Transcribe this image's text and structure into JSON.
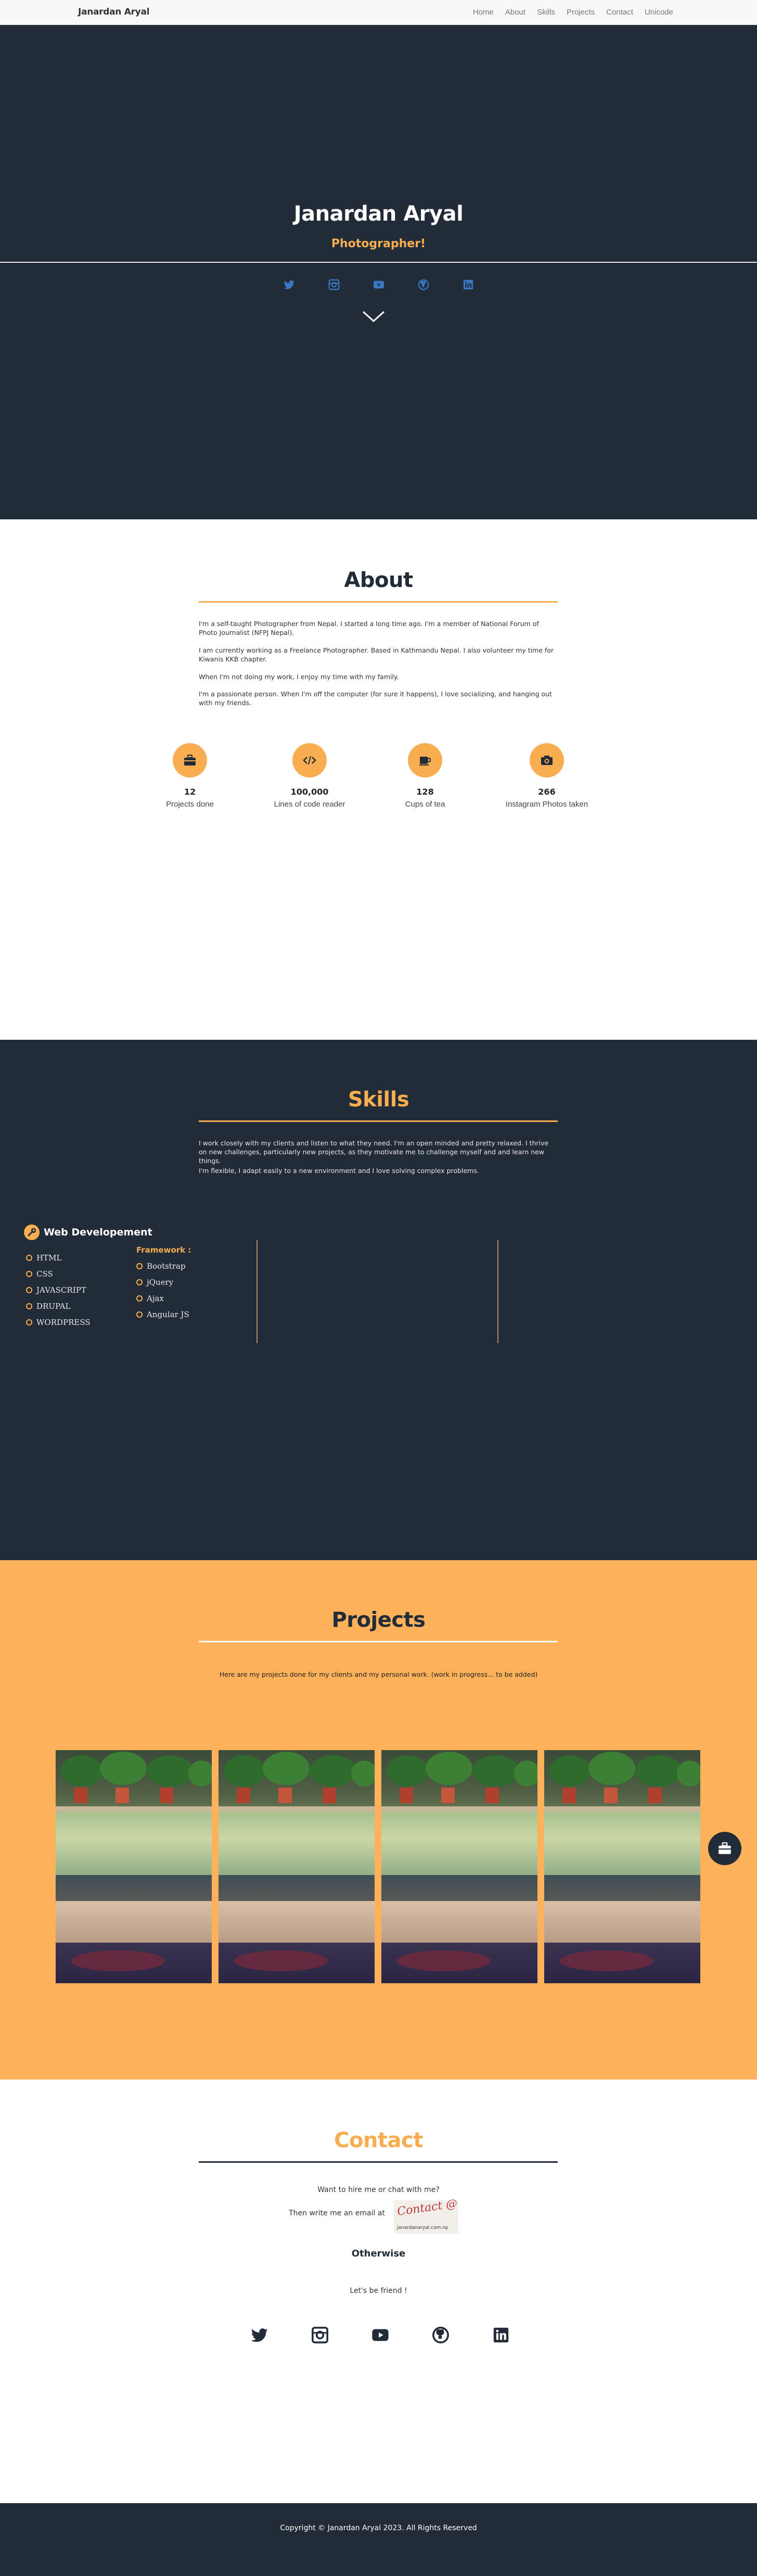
{
  "nav": {
    "brand": "Janardan Aryal",
    "links": [
      "Home",
      "About",
      "Skills",
      "Projects",
      "Contact",
      "Unicode"
    ]
  },
  "hero": {
    "name": "Janardan Aryal",
    "role": "Photographer!",
    "social_icons": [
      "twitter-icon",
      "instagram-icon",
      "youtube-icon",
      "github-icon",
      "linkedin-icon"
    ]
  },
  "about": {
    "title": "About",
    "paragraphs": [
      "I'm a self-taught Photographer from Nepal. I started a long time ago. I'm a member of National Forum of Photo Journalist (NFPJ Nepal).",
      "I am currently working as a Freelance Photographer. Based in Kathmandu Nepal. I also volunteer my time for Kiwanis KKB chapter.",
      "When I'm not doing my work, I enjoy my time with my family.",
      "I'm a passionate person. When I'm off the computer (for sure it happens), I love socializing, and hanging out with my friends."
    ],
    "stats": [
      {
        "icon": "briefcase-icon",
        "value": "12",
        "label": "Projects done"
      },
      {
        "icon": "code-icon",
        "value": "100,000",
        "label": "Lines of code reader"
      },
      {
        "icon": "coffee-icon",
        "value": "128",
        "label": "Cups of tea"
      },
      {
        "icon": "camera-icon",
        "value": "266",
        "label": "Instagram Photos taken"
      }
    ]
  },
  "skills": {
    "title": "Skills",
    "paragraphs": [
      "I work closely with my clients and listen to what they need. I'm an open minded and pretty relaxed. I thrive on new challenges, particularly new projects, as they motivate me to challenge myself and and learn new things.",
      "I'm flexible, I adapt easily to a new environment and I love solving complex problems."
    ],
    "category": "Web Developement",
    "languages": [
      "HTML",
      "CSS",
      "JAVASCRIPT",
      "DRUPAL",
      "WORDPRESS"
    ],
    "framework_title": "Framework :",
    "frameworks": [
      "Bootstrap",
      "jQuery",
      "Ajax",
      "Angular JS"
    ]
  },
  "projects": {
    "title": "Projects",
    "subtitle": "Here are my projects done for my clients and my personal work. (work in progress... to be added)"
  },
  "contact": {
    "title": "Contact",
    "line1": "Want to hire me or chat with me?",
    "line2": "Then write me an email at",
    "stamp_script": "Contact @",
    "stamp_email": "janardanaryal.com.np",
    "otherwise": "Otherwise",
    "line3": "Let's be friend !",
    "social_icons": [
      "twitter-icon",
      "instagram-icon",
      "youtube-icon",
      "github-icon",
      "linkedin-icon"
    ]
  },
  "footer": {
    "text": "Copyright © Janardan Aryal 2023. All Rights Reserved"
  },
  "colors": {
    "dark": "#222b38",
    "accent": "#f8ae50",
    "projects_bg": "#fdb15b",
    "social_blue": "#3a78c4"
  }
}
